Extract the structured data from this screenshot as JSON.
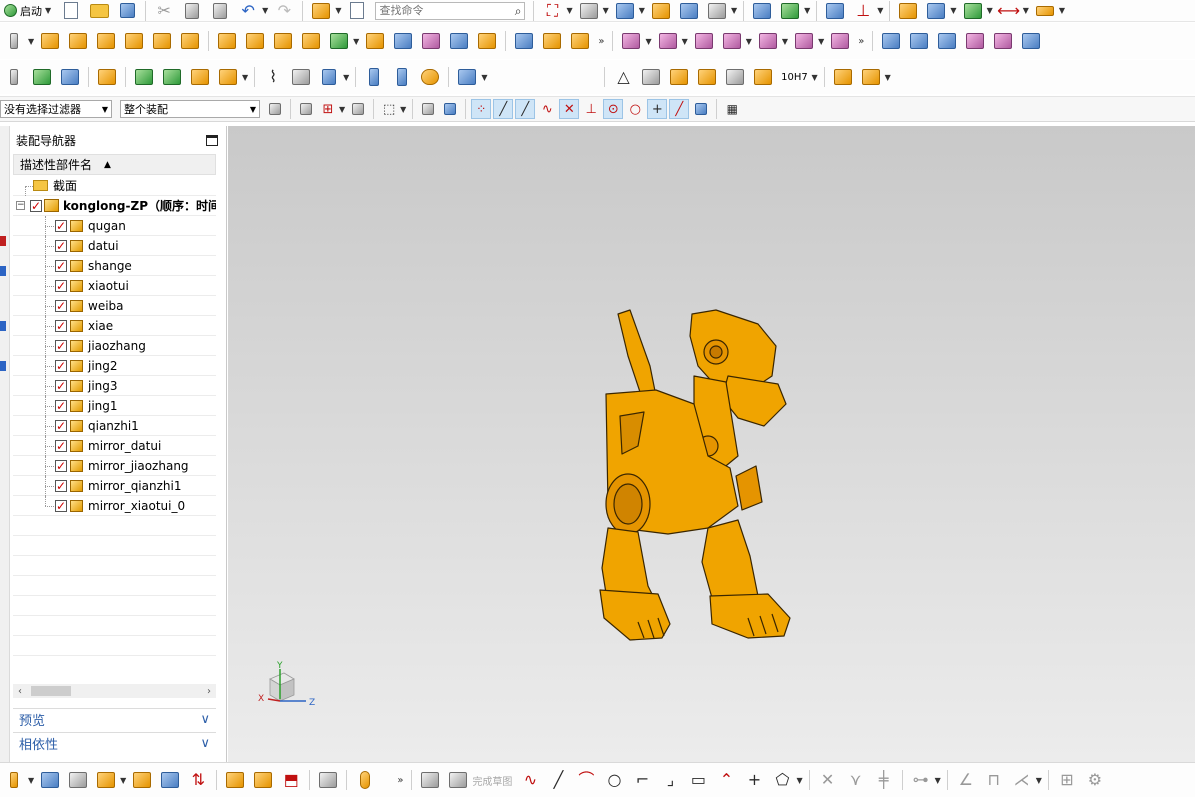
{
  "toolbar": {
    "start_label": "启动",
    "search_placeholder": "查找命令",
    "filter_label": "没有选择过滤器",
    "scope_label": "整个装配",
    "tolerance_label": "10H7"
  },
  "navigator": {
    "title": "装配导航器",
    "column_header": "描述性部件名",
    "sort_indicator": "▲",
    "section_label": "截面",
    "root": {
      "label": "konglong-ZP（顺序：时间",
      "checked": true
    },
    "parts": [
      {
        "label": "qugan"
      },
      {
        "label": "datui"
      },
      {
        "label": "shange"
      },
      {
        "label": "xiaotui"
      },
      {
        "label": "weiba"
      },
      {
        "label": "xiae"
      },
      {
        "label": "jiaozhang"
      },
      {
        "label": "jing2"
      },
      {
        "label": "jing3"
      },
      {
        "label": "jing1"
      },
      {
        "label": "qianzhi1"
      },
      {
        "label": "mirror_datui"
      },
      {
        "label": "mirror_jiaozhang"
      },
      {
        "label": "mirror_qianzhi1"
      },
      {
        "label": "mirror_xiaotui_0"
      }
    ],
    "accordion": [
      {
        "label": "预览",
        "chevron": "∨"
      },
      {
        "label": "相依性",
        "chevron": "∨"
      }
    ]
  },
  "viewport": {
    "model_color": "#f0a400",
    "background_top": "#c9c9c9",
    "background_bottom": "#ececec",
    "axes": {
      "x": "X",
      "y": "Y",
      "z": "Z"
    }
  },
  "bottom_toolbar": {
    "finish_sketch_label": "完成草图"
  },
  "colors": {
    "accordion_text": "#2c5ea8",
    "check_mark": "#d00000"
  }
}
